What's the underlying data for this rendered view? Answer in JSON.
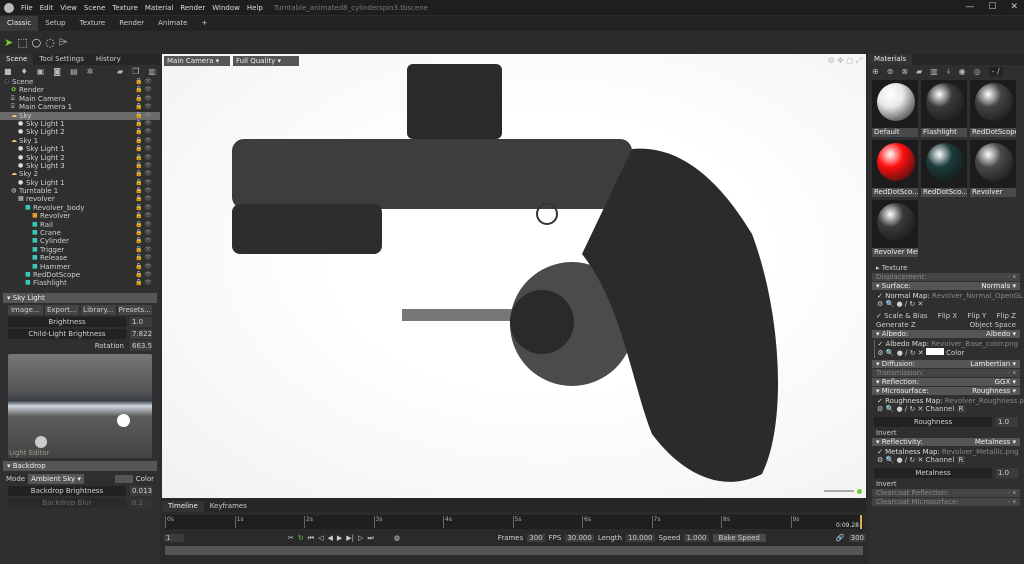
{
  "menu": {
    "items": [
      "File",
      "Edit",
      "View",
      "Scene",
      "Texture",
      "Material",
      "Render",
      "Window",
      "Help"
    ],
    "title": "Turntable_animated8_cylinderspin3.tbscene"
  },
  "layout_tabs": [
    "Classic",
    "Setup",
    "Texture",
    "Render",
    "Animate",
    "+"
  ],
  "left_panel": {
    "tabs": [
      "Scene",
      "Tool Settings",
      "History"
    ],
    "tree": [
      {
        "label": "Scene",
        "icon": "scene",
        "depth": 0
      },
      {
        "label": "Render",
        "icon": "render",
        "depth": 1
      },
      {
        "label": "Main Camera",
        "icon": "camera",
        "depth": 1
      },
      {
        "label": "Main Camera 1",
        "icon": "camera",
        "depth": 1
      },
      {
        "label": "Sky",
        "icon": "sky",
        "depth": 1,
        "selected": true
      },
      {
        "label": "Sky Light 1",
        "icon": "light",
        "depth": 2
      },
      {
        "label": "Sky Light 2",
        "icon": "light",
        "depth": 2
      },
      {
        "label": "Sky 1",
        "icon": "sky",
        "depth": 1
      },
      {
        "label": "Sky Light 1",
        "icon": "light",
        "depth": 2
      },
      {
        "label": "Sky Light 2",
        "icon": "light",
        "depth": 2
      },
      {
        "label": "Sky Light 3",
        "icon": "light",
        "depth": 2
      },
      {
        "label": "Sky 2",
        "icon": "sky",
        "depth": 1
      },
      {
        "label": "Sky Light 1",
        "icon": "light",
        "depth": 2
      },
      {
        "label": "Turntable 1",
        "icon": "turntable",
        "depth": 1
      },
      {
        "label": "revolver",
        "icon": "model",
        "depth": 2
      },
      {
        "label": "Revolver_body",
        "icon": "mesh",
        "depth": 3
      },
      {
        "label": "Revolver",
        "icon": "material",
        "depth": 4
      },
      {
        "label": "Rail",
        "icon": "mesh",
        "depth": 4
      },
      {
        "label": "Crane",
        "icon": "mesh",
        "depth": 4
      },
      {
        "label": "Cylinder",
        "icon": "mesh",
        "depth": 4
      },
      {
        "label": "Trigger",
        "icon": "mesh",
        "depth": 4
      },
      {
        "label": "Release",
        "icon": "mesh",
        "depth": 4
      },
      {
        "label": "Hammer",
        "icon": "mesh",
        "depth": 4
      },
      {
        "label": "RedDotScope",
        "icon": "mesh",
        "depth": 3
      },
      {
        "label": "Flashlight",
        "icon": "mesh",
        "depth": 3
      }
    ],
    "sky_light": {
      "title": "Sky Light",
      "buttons": [
        "Image...",
        "Export...",
        "Library...",
        "Presets..."
      ],
      "brightness_label": "Brightness",
      "brightness": "1.0",
      "child_label": "Child-Light Brightness",
      "child": "7.822",
      "rotation_label": "Rotation",
      "rotation": "663.5",
      "editor_label": "Light Editor"
    },
    "backdrop": {
      "title": "Backdrop",
      "mode_label": "Mode",
      "mode": "Ambient Sky",
      "color_label": "Color",
      "brightness_label": "Backdrop Brightness",
      "brightness": "0.013",
      "blur_label": "Backdrop Blur",
      "blur": "0.1"
    }
  },
  "viewport": {
    "camera": "Main Camera",
    "quality": "Full Quality"
  },
  "materials": {
    "tab": "Materials",
    "counter": "- /",
    "items": [
      {
        "name": "Default",
        "color": "#e8e8e8"
      },
      {
        "name": "Flashlight",
        "color": "#3a3a3a"
      },
      {
        "name": "RedDotScope",
        "color": "#444"
      },
      {
        "name": "RedDotSco...",
        "color": "#ff1010"
      },
      {
        "name": "RedDotSco...",
        "color": "#1d3a3a"
      },
      {
        "name": "Revolver",
        "color": "#4a4a4a"
      },
      {
        "name": "Revolver Metal",
        "color": "#3a3a3a"
      }
    ],
    "sections": {
      "texture": "Texture",
      "displacement": "Displacement:",
      "surface": "Surface:",
      "surface_val": "Normals",
      "normal_map_label": "Normal Map:",
      "normal_map": "Revolver_Normal_OpenGL",
      "scale_bias": "Scale & Bias",
      "flip_x": "Flip X",
      "flip_y": "Flip Y",
      "flip_z": "Flip Z",
      "generate_z": "Generate Z",
      "object_space": "Object Space",
      "albedo": "Albedo:",
      "albedo_val": "Albedo",
      "albedo_map_label": "Albedo Map:",
      "albedo_map": "Revolver_Base_color.png",
      "color": "Color",
      "diffusion": "Diffusion:",
      "diffusion_val": "Lambertian",
      "transmission": "Transmission:",
      "reflection": "Reflection:",
      "reflection_val": "GGX",
      "microsurface": "Microsurface:",
      "micro_val": "Roughness",
      "roughness_map_label": "Roughness Map:",
      "roughness_map": "Revolver_Roughness.png",
      "channel": "Channel",
      "channel_val": "R",
      "roughness": "Roughness",
      "roughness_value": "1.0",
      "invert": "Invert",
      "reflectivity": "Reflectivity:",
      "reflectivity_val": "Metalness",
      "metal_map_label": "Metalness Map:",
      "metal_map": "Revolver_Metallic.png",
      "metalness": "Metalness",
      "metalness_value": "1.0",
      "clearcoat_refl": "Clearcoat Reflection:",
      "clearcoat_micro": "Clearcoat Microsurface:",
      "dash": "-"
    }
  },
  "timeline": {
    "tabs": [
      "Timeline",
      "Keyframes"
    ],
    "ticks": [
      "0s",
      "1s",
      "2s",
      "3s",
      "4s",
      "5s",
      "6s",
      "7s",
      "8s",
      "9s"
    ],
    "current_time": "0:09.28",
    "frame": "1",
    "frames_label": "Frames",
    "frames": "300",
    "fps_label": "FPS",
    "fps": "30.000",
    "length_label": "Length",
    "length": "10.000",
    "speed_label": "Speed",
    "speed": "1.000",
    "bake": "Bake Speed",
    "end_frame": "300"
  }
}
